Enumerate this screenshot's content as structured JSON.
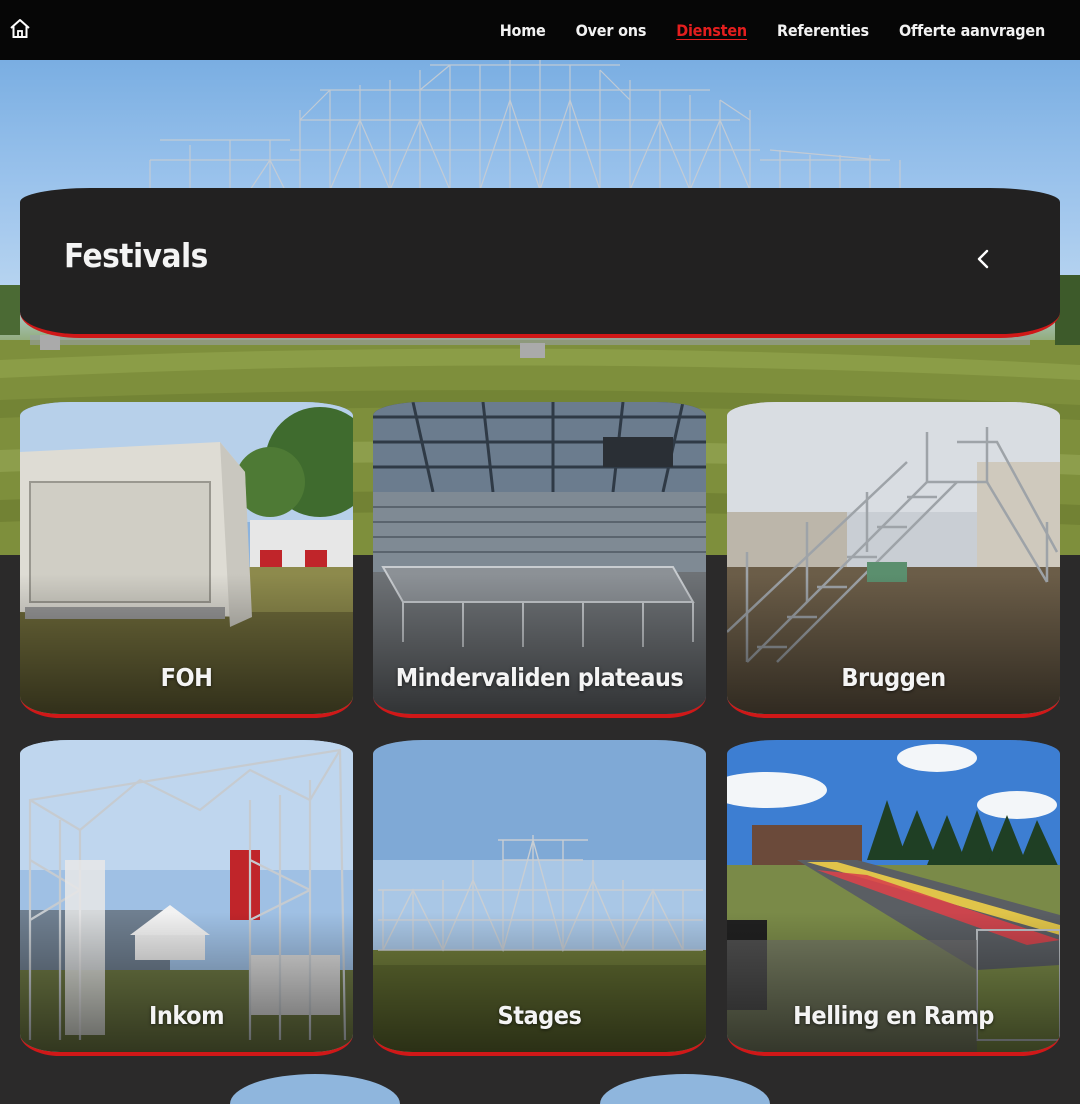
{
  "nav": {
    "home_icon": "home-icon",
    "links": [
      {
        "label": "Home",
        "active": false
      },
      {
        "label": "Over ons",
        "active": false
      },
      {
        "label": "Diensten",
        "active": true
      },
      {
        "label": "Referenties",
        "active": false
      },
      {
        "label": "Offerte aanvragen",
        "active": false
      }
    ]
  },
  "page": {
    "title": "Festivals",
    "back_icon": "chevron-left-icon"
  },
  "cards": [
    {
      "label": "FOH"
    },
    {
      "label": "Mindervaliden plateaus"
    },
    {
      "label": "Bruggen"
    },
    {
      "label": "Inkom"
    },
    {
      "label": "Stages"
    },
    {
      "label": "Helling en Ramp"
    }
  ],
  "colors": {
    "accent": "#d01818",
    "active_link": "#e41e1e",
    "nav_bg": "#060606",
    "page_bg": "#2b2a2a",
    "card_bg": "#222121"
  }
}
